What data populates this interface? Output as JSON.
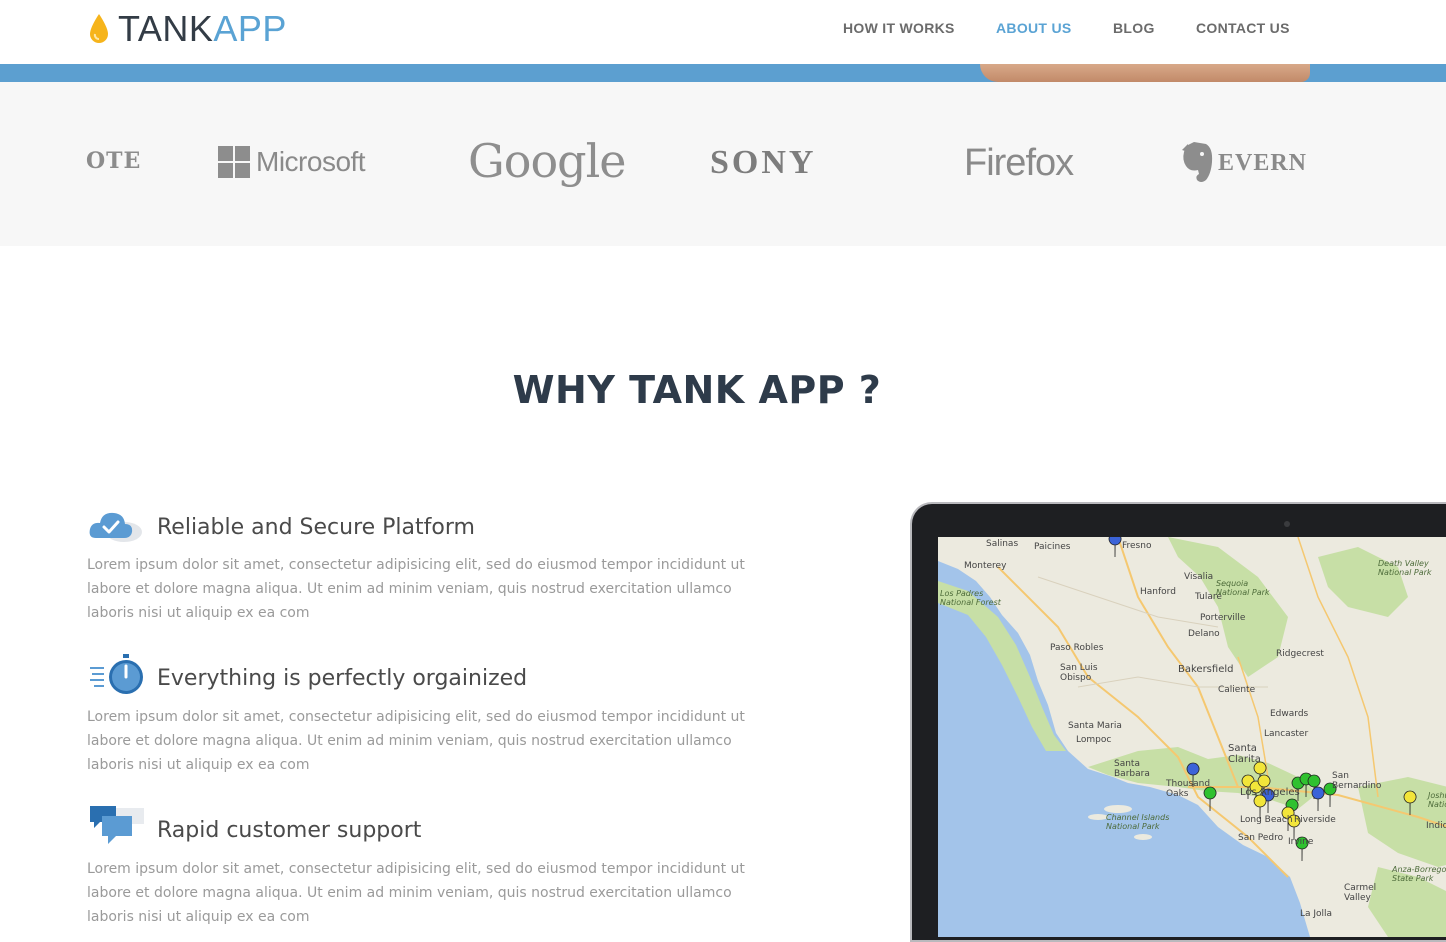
{
  "header": {
    "logo": {
      "tank": "TANK",
      "app": "APP"
    },
    "nav": [
      {
        "label": "HOW IT WORKS",
        "active": false
      },
      {
        "label": "ABOUT US",
        "active": true
      },
      {
        "label": "BLOG",
        "active": false
      },
      {
        "label": "CONTACT US",
        "active": false
      }
    ]
  },
  "clients": [
    {
      "name": "OTE",
      "icon": "evernote-partial-logo"
    },
    {
      "name": "Microsoft",
      "icon": "windows-logo-icon"
    },
    {
      "name": "Google",
      "icon": ""
    },
    {
      "name": "SONY",
      "icon": ""
    },
    {
      "name": "Firefox",
      "icon": ""
    },
    {
      "name": "EVERN",
      "icon": "elephant-icon"
    }
  ],
  "section": {
    "title": "WHY TANK APP ?"
  },
  "features": [
    {
      "title": "Reliable and Secure Platform",
      "icon": "cloud-check-icon",
      "text": "Lorem ipsum dolor sit amet, consectetur adipisicing elit, sed do eiusmod tempor incididunt ut labore et dolore magna aliqua. Ut enim ad minim veniam, quis nostrud exercitation ullamco laboris nisi ut aliquip ex ea com"
    },
    {
      "title": "Everything is perfectly orgainized",
      "icon": "stopwatch-icon",
      "text": "Lorem ipsum dolor sit amet, consectetur adipisicing elit, sed do eiusmod tempor incididunt ut labore et dolore magna aliqua. Ut enim ad minim veniam, quis nostrud exercitation ullamco laboris nisi ut aliquip ex ea com"
    },
    {
      "title": "Rapid customer support",
      "icon": "chat-bubbles-icon",
      "text": "Lorem ipsum dolor sit amet, consectetur adipisicing elit, sed do eiusmod tempor incididunt ut labore et dolore magna aliqua. Ut enim ad minim veniam, quis nostrud exercitation ullamco laboris nisi ut aliquip ex ea com"
    }
  ],
  "map": {
    "labels": [
      "Salinas",
      "Paicines",
      "Fresno",
      "Monterey",
      "Visalia",
      "Hanford",
      "Tulare",
      "Sequoia National Park",
      "Los Padres National Forest",
      "Porterville",
      "Delano",
      "Paso Robles",
      "Ridgecrest",
      "San Luis Obispo",
      "Bakersfield",
      "Caliente",
      "Edwards",
      "Santa Maria",
      "Lancaster",
      "Lompoc",
      "Santa Clarita",
      "Santa Barbara",
      "Thousand Oaks",
      "Los Angeles",
      "San Bernardino",
      "Long Beach",
      "Riverside",
      "San Pedro",
      "Irvine",
      "Channel Islands National Park",
      "Death Valley National Park",
      "Joshua Tree National Park",
      "Indio",
      "Anza-Borrego Desert State Park",
      "Carmel Valley",
      "La Jolla"
    ],
    "colors": {
      "water": "#a3c4ea",
      "land": "#eceadf",
      "park": "#c7dfa6",
      "road": "#f5c870",
      "pin_yellow": "#f2e53a",
      "pin_green": "#2fc12f",
      "pin_blue": "#3b63d8"
    }
  }
}
